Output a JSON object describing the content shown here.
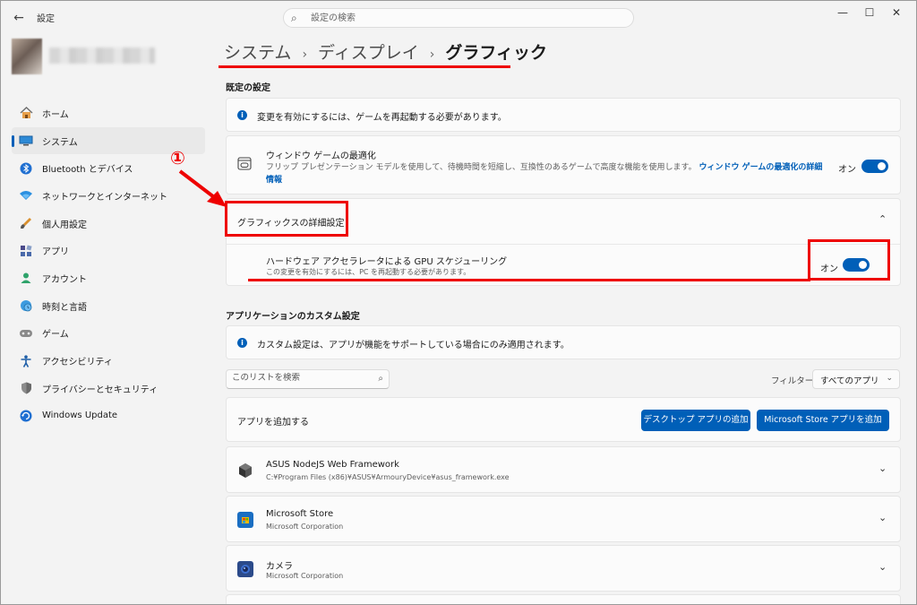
{
  "window": {
    "title": "設定",
    "back_glyph": "←",
    "minimize_glyph": "—",
    "maximize_glyph": "☐",
    "close_glyph": "✕"
  },
  "search": {
    "placeholder": "設定の検索"
  },
  "sidebar": {
    "items": [
      {
        "label": "ホーム",
        "icon": "home-icon"
      },
      {
        "label": "システム",
        "icon": "system-icon",
        "active": true
      },
      {
        "label": "Bluetooth とデバイス",
        "icon": "bluetooth-icon"
      },
      {
        "label": "ネットワークとインターネット",
        "icon": "network-icon"
      },
      {
        "label": "個人用設定",
        "icon": "personalization-icon"
      },
      {
        "label": "アプリ",
        "icon": "apps-icon"
      },
      {
        "label": "アカウント",
        "icon": "account-icon"
      },
      {
        "label": "時刻と言語",
        "icon": "time-language-icon"
      },
      {
        "label": "ゲーム",
        "icon": "gaming-icon"
      },
      {
        "label": "アクセシビリティ",
        "icon": "accessibility-icon"
      },
      {
        "label": "プライバシーとセキュリティ",
        "icon": "privacy-shield-icon"
      },
      {
        "label": "Windows Update",
        "icon": "windows-update-icon"
      }
    ]
  },
  "breadcrumb": {
    "level1": "システム",
    "level2": "ディスプレイ",
    "current": "グラフィック",
    "separator": "›"
  },
  "default_settings": {
    "heading": "既定の設定",
    "info": "変更を有効にするには、ゲームを再起動する必要があります。",
    "window_opt": {
      "title": "ウィンドウ ゲームの最適化",
      "desc": "フリップ プレゼンテーション モデルを使用して、待機時間を短縮し、互換性のあるゲームで高度な機能を使用します。",
      "link": "ウィンドウ ゲームの最適化の詳細情報",
      "state": "オン",
      "on": true
    },
    "advanced": {
      "title": "グラフィックスの詳細設定",
      "gpu_title": "ハードウェア アクセラレータによる GPU スケジューリング",
      "gpu_desc": "この変更を有効にするには、PC を再起動する必要があります。",
      "state": "オン",
      "on": true
    }
  },
  "annotation": {
    "marker": "①"
  },
  "custom_settings": {
    "heading": "アプリケーションのカスタム設定",
    "info": "カスタム設定は、アプリが機能をサポートしている場合にのみ適用されます。",
    "list_search_placeholder": "このリストを検索",
    "filter_label": "フィルター:",
    "filter_value": "すべてのアプリ",
    "add_app_label": "アプリを追加する",
    "add_desktop_button": "デスクトップ アプリの追加",
    "add_store_button": "Microsoft Store アプリを追加",
    "apps": [
      {
        "name": "ASUS NodeJS Web Framework",
        "sub": "C:¥Program Files (x86)¥ASUS¥ArmouryDevice¥asus_framework.exe"
      },
      {
        "name": "Microsoft Store",
        "sub": "Microsoft Corporation"
      },
      {
        "name": "カメラ",
        "sub": "Microsoft Corporation"
      }
    ]
  },
  "colors": {
    "accent": "#005fb8",
    "annotation_red": "#e00000"
  }
}
